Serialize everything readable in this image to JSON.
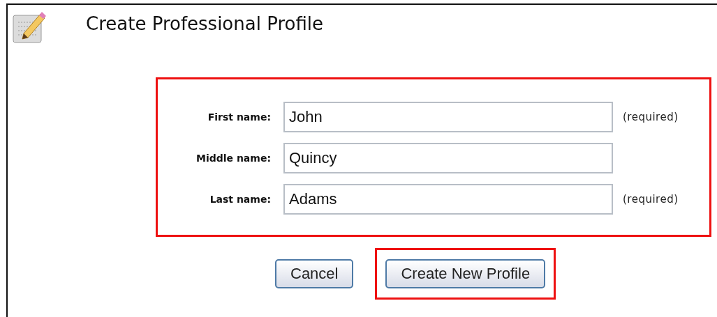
{
  "title": "Create Professional Profile",
  "form": {
    "highlighted": true,
    "fields": [
      {
        "label": "First name:",
        "value": "John",
        "note": "(required)"
      },
      {
        "label": "Middle name:",
        "value": "Quincy"
      },
      {
        "label": "Last name:",
        "value": "Adams",
        "note": "(required)"
      }
    ]
  },
  "buttons": [
    {
      "label": "Cancel",
      "highlighted": false
    },
    {
      "label": "Create New Profile",
      "highlighted": true
    }
  ]
}
